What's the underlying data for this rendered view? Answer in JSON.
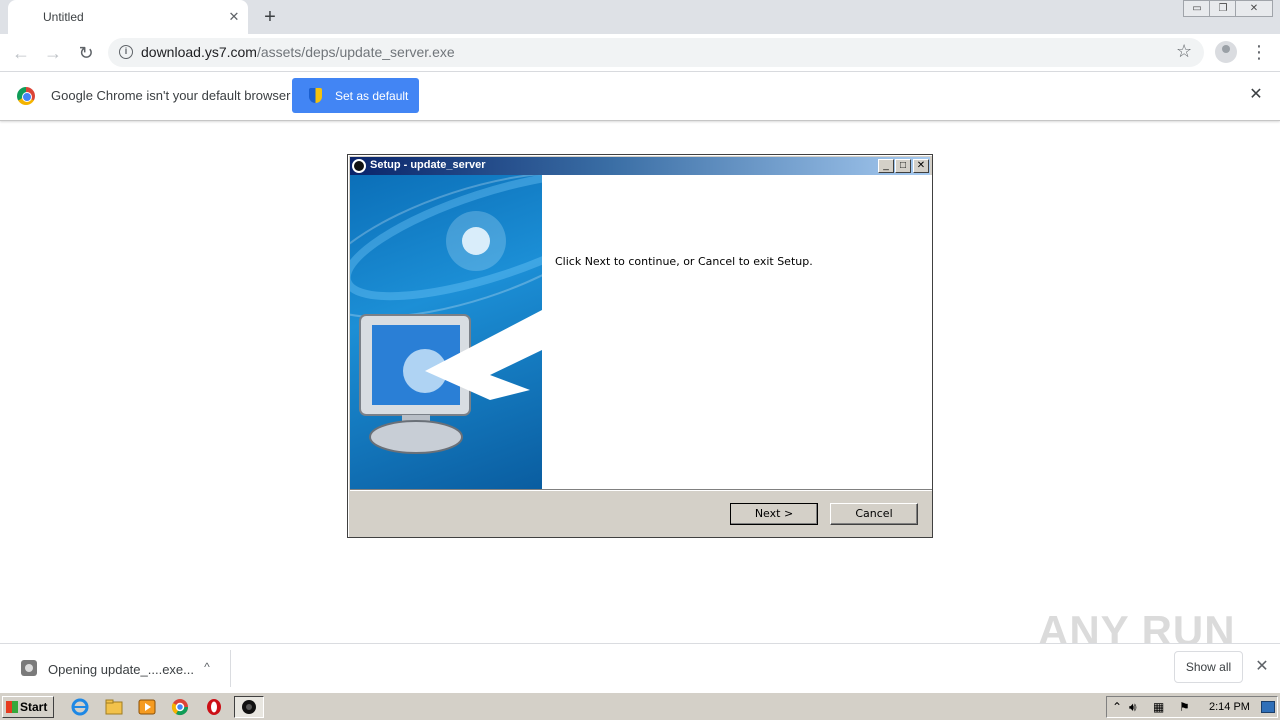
{
  "browser": {
    "tab": {
      "title": "Untitled",
      "close_label": "✕"
    },
    "new_tab_label": "+",
    "window_controls": {
      "minimize": "▭",
      "restore": "❐",
      "close": "✕"
    },
    "nav": {
      "back": "←",
      "forward": "→",
      "reload": "↻"
    },
    "address": {
      "host": "download.ys7.com",
      "path": "/assets/deps/update_server.exe"
    },
    "bookmark_icon": "☆",
    "menu_icon": "⋮"
  },
  "infobar": {
    "message": "Google Chrome isn't your default browser",
    "button_label": "Set as default",
    "close_label": "✕"
  },
  "setup_dialog": {
    "title": "Setup - update_server",
    "controls": {
      "minimize": "_",
      "maximize": "□",
      "close": "✕"
    },
    "message": "Click Next to continue, or Cancel to exit Setup.",
    "next_label": "Next >",
    "cancel_label": "Cancel"
  },
  "download_shelf": {
    "item_label": "Opening update_....exe...",
    "chevron": "^",
    "show_all_label": "Show all",
    "close_label": "✕"
  },
  "watermark": "ANY RUN",
  "taskbar": {
    "start_label": "Start",
    "clock": "2:14 PM",
    "tray_arrow": "⌃"
  },
  "colors": {
    "chrome_blue": "#4285f4",
    "titlebar_start": "#0a246a",
    "titlebar_end": "#a6caf0",
    "win_face": "#d4d0c8"
  }
}
